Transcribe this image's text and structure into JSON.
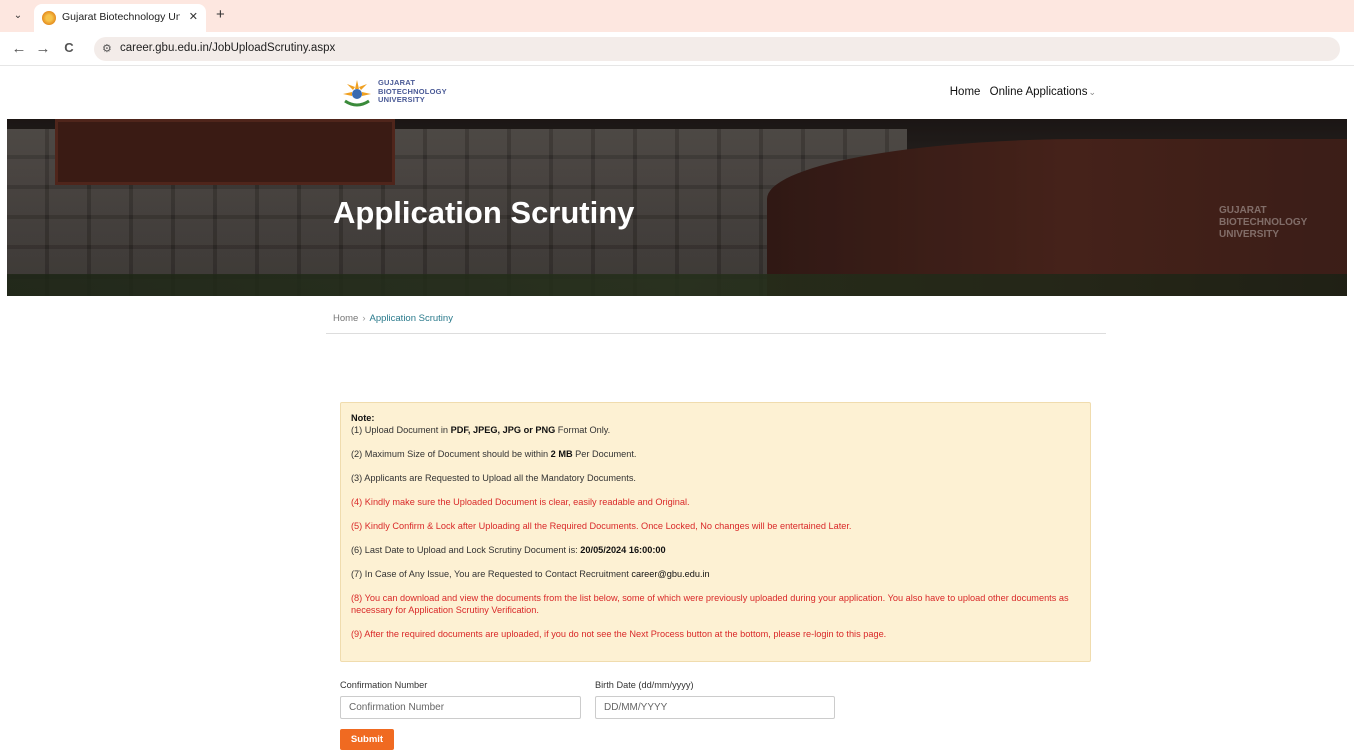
{
  "browser": {
    "tab_title": "Gujarat Biotechnology Universi",
    "tab_close": "✕",
    "new_tab": "+",
    "url": "career.gbu.edu.in/JobUploadScrutiny.aspx",
    "back": "←",
    "forward": "→",
    "reload": "C",
    "menu": "⌄"
  },
  "header": {
    "logo_lines": [
      "GUJARAT",
      "BIOTECHNOLOGY",
      "UNIVERSITY"
    ],
    "nav": {
      "home": "Home",
      "online_applications": "Online Applications",
      "chevron": "⌄"
    }
  },
  "hero": {
    "title": "Application Scrutiny",
    "watermark": [
      "GUJARAT",
      "BIOTECHNOLOGY",
      "UNIVERSITY"
    ]
  },
  "breadcrumb": {
    "home": "Home",
    "sep": "›",
    "current": "Application Scrutiny"
  },
  "notes": {
    "title": "Note:",
    "n1_a": "(1) Upload Document in ",
    "n1_b": "PDF, JPEG, JPG or PNG",
    "n1_c": " Format Only.",
    "n2_a": "(2) Maximum Size of Document should be within ",
    "n2_b": "2 MB",
    "n2_c": " Per Document.",
    "n3": "(3) Applicants are Requested to Upload all the Mandatory Documents.",
    "n4": "(4) Kindly make sure the Uploaded Document is clear, easily readable and Original.",
    "n5": "(5) Kindly Confirm & Lock after Uploading all the Required Documents. Once Locked, No changes will be entertained Later.",
    "n6_a": "(6) Last Date to Upload and Lock Scrutiny Document is: ",
    "n6_b": "20/05/2024 16:00:00",
    "n7_a": "(7) In Case of Any Issue, You are Requested to Contact Recruitment ",
    "n7_b": "career@gbu.edu.in",
    "n8": "(8) You can download and view the documents from the list below, some of which were previously uploaded during your application. You also have to upload other documents as necessary for Application Scrutiny Verification.",
    "n9": "(9) After the required documents are uploaded, if you do not see the Next Process button at the bottom, please re-login to this page."
  },
  "form": {
    "confirmation_label": "Confirmation Number",
    "confirmation_placeholder": "Confirmation Number",
    "birthdate_label": "Birth Date (dd/mm/yyyy)",
    "birthdate_placeholder": "DD/MM/YYYY",
    "submit_label": "Submit"
  },
  "colors": {
    "accent": "#f06a21",
    "note_bg": "#fdf1d3",
    "note_red": "#d92929",
    "breadcrumb_current": "#2a7a8c"
  }
}
